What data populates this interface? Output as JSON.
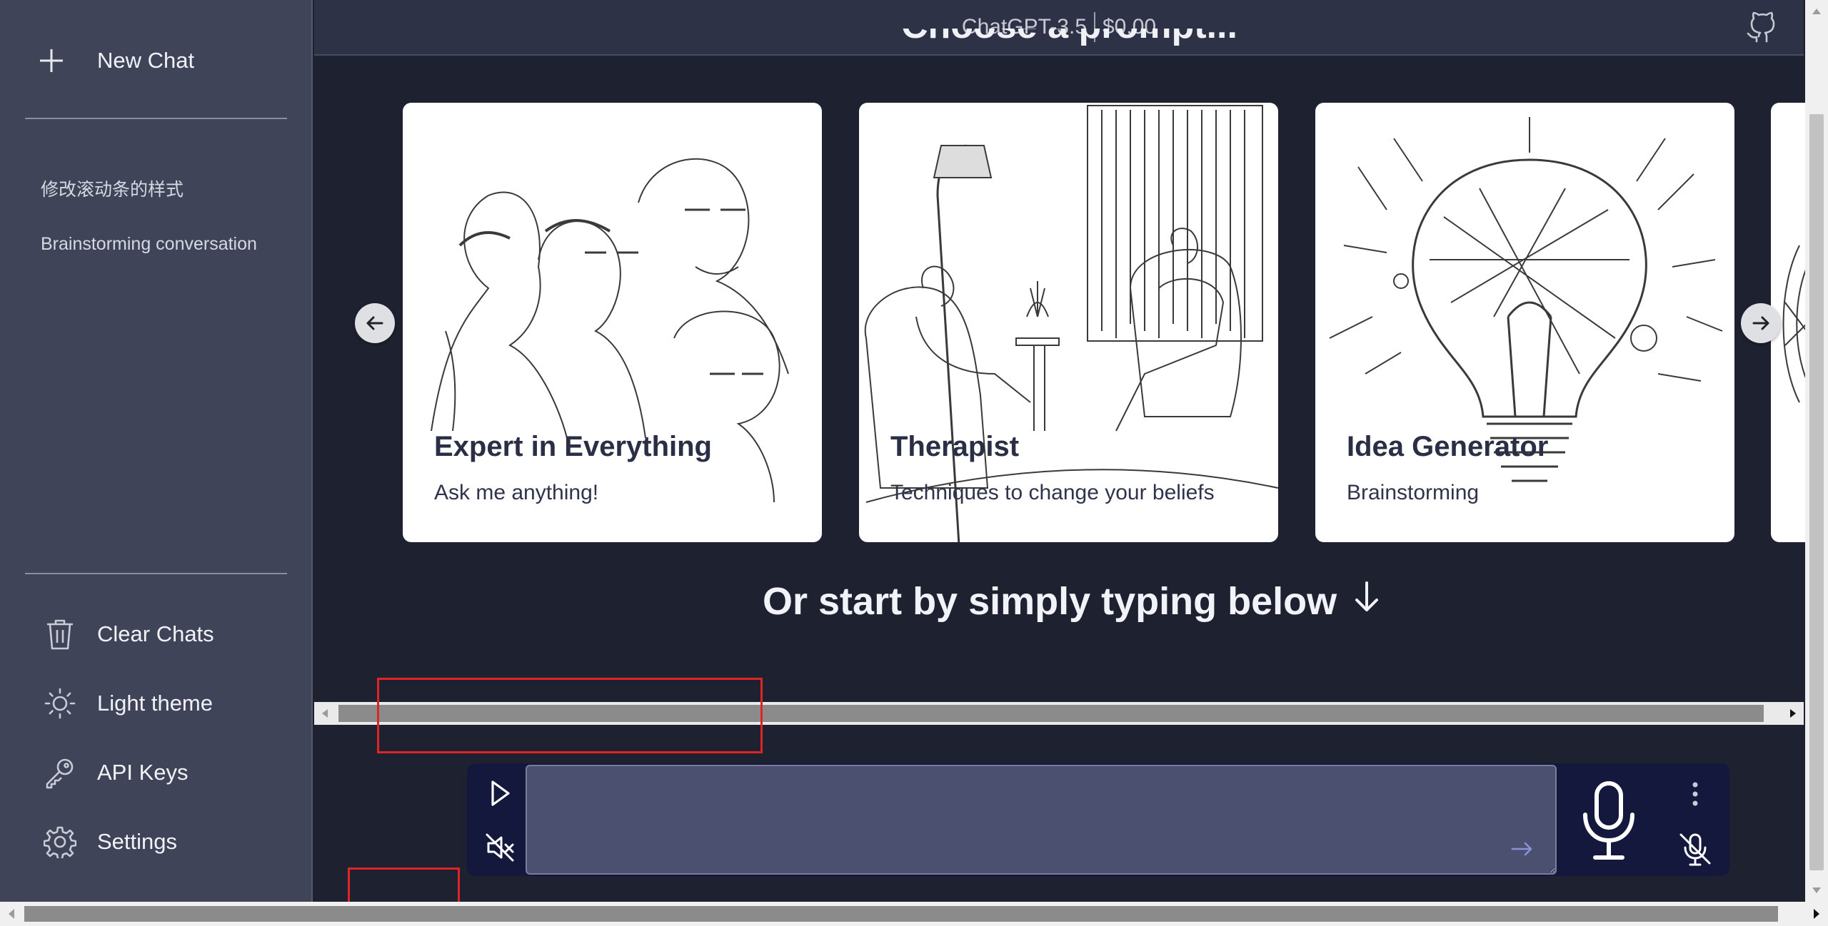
{
  "header": {
    "model": "ChatGPT-3.5",
    "cost": "$0.00"
  },
  "sidebar": {
    "new_chat_label": "New Chat",
    "history": [
      {
        "label": "修改滚动条的样式"
      },
      {
        "label": "Brainstorming conversation"
      }
    ],
    "menu": [
      {
        "label": "Clear Chats",
        "icon": "trash-icon"
      },
      {
        "label": "Light theme",
        "icon": "sun-icon"
      },
      {
        "label": "API Keys",
        "icon": "key-icon"
      },
      {
        "label": "Settings",
        "icon": "gear-icon"
      }
    ]
  },
  "main": {
    "title": "Choose a prompt...",
    "cards": [
      {
        "title": "Expert in Everything",
        "description": "Ask me anything!"
      },
      {
        "title": "Therapist",
        "description": "Techniques to change your beliefs"
      },
      {
        "title": "Idea Generator",
        "description": "Brainstorming"
      }
    ],
    "or_start": "Or start by simply typing below"
  },
  "input": {
    "value": "",
    "placeholder": ""
  },
  "colors": {
    "sidebar_bg": "#404459",
    "main_bg": "#1e2130",
    "header_bg": "#2e3247",
    "input_bar_bg": "#14183d",
    "textarea_bg": "#4c5070",
    "annotation_red": "#e02424"
  }
}
